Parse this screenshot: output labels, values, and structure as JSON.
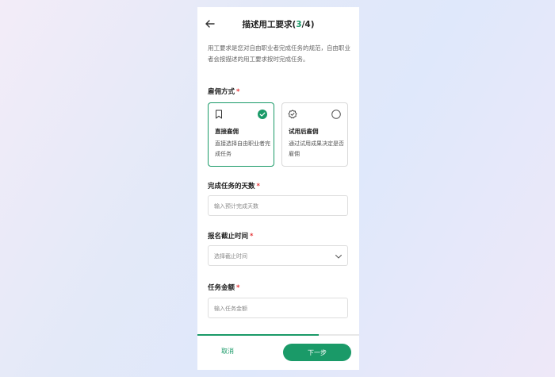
{
  "header": {
    "title": "描述用工要求",
    "step_open": "(",
    "step_current": "3",
    "step_rest": "/4)"
  },
  "description": "用工要求是您对自由职业者完成任务的规范，自由职业者会按描述的用工要求按时完成任务。",
  "employment": {
    "label": "雇佣方式",
    "required_mark": "*",
    "options": [
      {
        "icon": "bookmark-icon",
        "title": "直接雇佣",
        "desc": "直接选择自由职业者完成任务",
        "selected": true
      },
      {
        "icon": "badge-check-icon",
        "title": "试用后雇佣",
        "desc": "通过试用成果决定是否雇佣",
        "selected": false
      }
    ]
  },
  "days": {
    "label": "完成任务的天数",
    "required_mark": "*",
    "placeholder": "输入预计完成天数"
  },
  "deadline": {
    "label": "报名截止时间",
    "required_mark": "*",
    "placeholder": "选择截止时间"
  },
  "amount": {
    "label": "任务金额",
    "required_mark": "*",
    "placeholder": "输入任务金额"
  },
  "progress": {
    "fraction": 0.75
  },
  "footer": {
    "cancel_label": "取消",
    "next_label": "下一步"
  },
  "colors": {
    "accent": "#1a9a68",
    "required": "#e5393b"
  }
}
